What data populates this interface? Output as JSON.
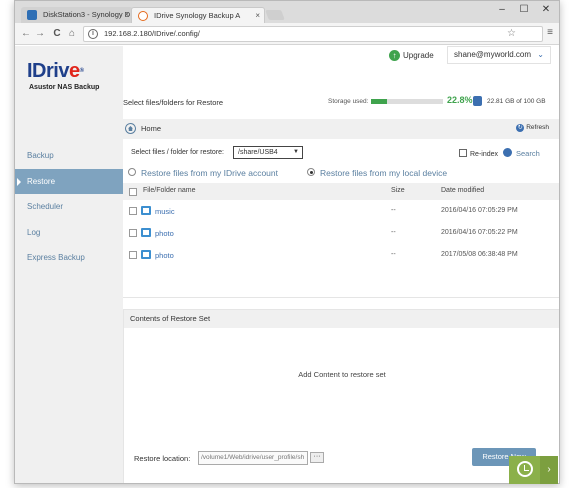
{
  "browser": {
    "tabs": [
      {
        "label": "DiskStation3 - Synology D"
      },
      {
        "label": "IDrive Synology Backup A"
      }
    ],
    "tab_close": "×",
    "controls": {
      "minimize": "–",
      "maximize": "☐",
      "close": "✕"
    },
    "address": "192.168.2.180/IDrive/.config/",
    "back": "←",
    "forward": "→",
    "reload": "C",
    "home": "⌂",
    "info": "i",
    "star": "☆",
    "menu": "≡"
  },
  "app": {
    "logo": {
      "brand_main": "IDriv",
      "brand_e": "e",
      "reg": "®",
      "subtitle": "Asustor NAS Backup"
    },
    "header": {
      "upgrade_label": "Upgrade",
      "upgrade_icon": "↑",
      "user": "shane@myworld.com",
      "user_chevron": "⌄"
    },
    "sidebar": {
      "items": [
        {
          "label": "Backup",
          "active": false
        },
        {
          "label": "Restore",
          "active": true
        },
        {
          "label": "Scheduler",
          "active": false
        },
        {
          "label": "Log",
          "active": false
        },
        {
          "label": "Express Backup",
          "active": false
        }
      ]
    },
    "page": {
      "title": "Select files/folders for Restore",
      "storage_label": "Storage used:",
      "storage_fraction": 0.228,
      "storage_pct": "22.8%",
      "storage_used": "22.81 GB of 100 GB",
      "breadcrumb": "Home",
      "refresh": "Refresh",
      "refresh_icon": "↻",
      "select_label": "Select files / folder for restore:",
      "select_value": "/share/USB4",
      "select_arrow": "▼",
      "reindex": "Re-index",
      "search": "Search",
      "radio_account": "Restore files from my IDrive account",
      "radio_local": "Restore files from my local device",
      "radio_selected": "local"
    },
    "table": {
      "columns": [
        "File/Folder name",
        "Size",
        "Date modified"
      ],
      "rows": [
        {
          "name": "music",
          "size": "--",
          "date": "2016/04/16 07:05:29 PM"
        },
        {
          "name": "photo",
          "size": "--",
          "date": "2016/04/16 07:05:22 PM"
        },
        {
          "name": "photo",
          "size": "--",
          "date": "2017/05/08 06:38:48 PM"
        }
      ]
    },
    "restore_set": {
      "title": "Contents of Restore Set",
      "empty": "Add Content to restore set",
      "location_label": "Restore location:",
      "location_value": "/volume1/Web/idrive/user_profile/sh",
      "browse": "···",
      "button": "Restore Now"
    },
    "corner": {
      "arrow": "›"
    }
  },
  "colors": {
    "brand_blue": "#1f3f8a",
    "brand_red": "#e1251b",
    "accent_green": "#3fa34d",
    "sidebar_active": "#7fa3bf",
    "button": "#6c96b8",
    "link": "#5a7fa0"
  }
}
